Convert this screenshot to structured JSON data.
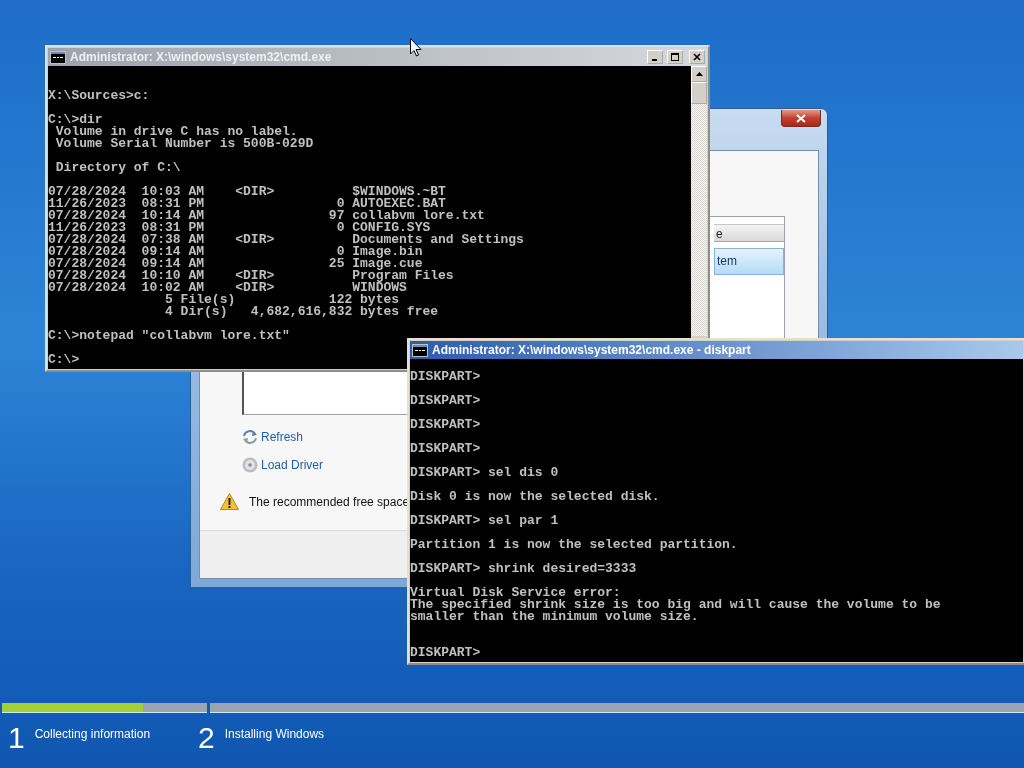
{
  "setup_window": {
    "list": {
      "header": "e",
      "rows": [
        {
          "text": "tem",
          "selected": true
        }
      ]
    },
    "links": [
      {
        "kind": "refresh",
        "label": "Refresh"
      },
      {
        "kind": "disc",
        "label": "Load Driver"
      }
    ],
    "warning": "The recommended free space"
  },
  "console_windows": [
    {
      "title": "Administrator: X:\\windows\\system32\\cmd.exe",
      "active": false,
      "blocks": [
        [
          "X:\\Sources>c:"
        ],
        [
          "C:\\>dir",
          " Volume in drive C has no label.",
          " Volume Serial Number is 500B-029D"
        ],
        [
          " Directory of C:\\"
        ],
        [
          "07/28/2024  10:03 AM    <DIR>          $WINDOWS.~BT",
          "11/26/2023  08:31 PM                 0 AUTOEXEC.BAT",
          "07/28/2024  10:14 AM                97 collabvm lore.txt",
          "11/26/2023  08:31 PM                 0 CONFIG.SYS",
          "07/28/2024  07:38 AM    <DIR>          Documents and Settings",
          "07/28/2024  09:14 AM                 0 Image.bin",
          "07/28/2024  09:14 AM                25 Image.cue",
          "07/28/2024  10:10 AM    <DIR>          Program Files",
          "07/28/2024  10:02 AM    <DIR>          WINDOWS",
          "               5 File(s)            122 bytes",
          "               4 Dir(s)   4,682,616,832 bytes free"
        ],
        [
          "C:\\>notepad \"collabvm lore.txt\""
        ]
      ],
      "prompt": "C:\\>"
    },
    {
      "title": "Administrator: X:\\windows\\system32\\cmd.exe - diskpart",
      "active": true,
      "blocks": [
        [
          "DISKPART>"
        ],
        [
          "DISKPART>"
        ],
        [
          "DISKPART>"
        ],
        [
          "DISKPART>"
        ],
        [
          "DISKPART> sel dis 0"
        ],
        [
          "Disk 0 is now the selected disk."
        ],
        [
          "DISKPART> sel par 1"
        ],
        [
          "Partition 1 is now the selected partition."
        ],
        [
          "DISKPART> shrink desired=3333"
        ],
        [
          "Virtual Disk Service error:",
          "The specified shrink size is too big and will cause the volume to be",
          "smaller than the minimum volume size."
        ]
      ],
      "prompt": "DISKPART>"
    }
  ],
  "progress_steps": [
    {
      "number": "1",
      "label": "Collecting information",
      "level": 0.69
    },
    {
      "number": "2",
      "label": "Installing Windows"
    }
  ]
}
